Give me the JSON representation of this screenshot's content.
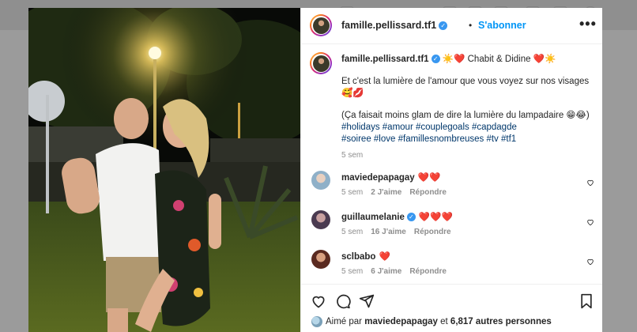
{
  "post": {
    "username": "famille.pellissard.tf1",
    "follow_label": "S'abonner",
    "more_label": "•••",
    "caption": {
      "title": "☀️❤️ Chabit & Didine ❤️☀️",
      "line1": "Et c'est la lumière de l'amour que vous voyez sur nos visages",
      "line2": "🥰💋",
      "line3": "(Ça faisait moins glam de dire la lumière du lampadaire 😁😂)",
      "tags1": "#holidays #amour #couplegoals #capdagde",
      "tags2": "#soiree #love #famillesnombreuses #tv #tf1",
      "time": "5 sem"
    },
    "comments": [
      {
        "user": "maviedepapagay",
        "text": "❤️❤️",
        "time": "5 sem",
        "likes": "2 J'aime",
        "reply": "Répondre",
        "verified": false
      },
      {
        "user": "guillaumelanie",
        "text": "❤️❤️❤️",
        "time": "5 sem",
        "likes": "16 J'aime",
        "reply": "Répondre",
        "verified": true
      },
      {
        "user": "sclbabo",
        "text": "❤️",
        "time": "5 sem",
        "likes": "6 J'aime",
        "reply": "Répondre",
        "verified": false
      }
    ],
    "liked_by": {
      "prefix": "Aimé par",
      "user": "maviedepapagay",
      "middle": "et",
      "others": "6,817 autres personnes"
    }
  },
  "icons": {
    "like": "heart-icon",
    "comment": "comment-icon",
    "share": "share-icon",
    "save": "bookmark-icon",
    "verified": "verified-badge-icon"
  },
  "colors": {
    "link": "#0095f6",
    "hashtag": "#00376b",
    "heart": "#ed4956",
    "meta": "#8e8e8e"
  }
}
